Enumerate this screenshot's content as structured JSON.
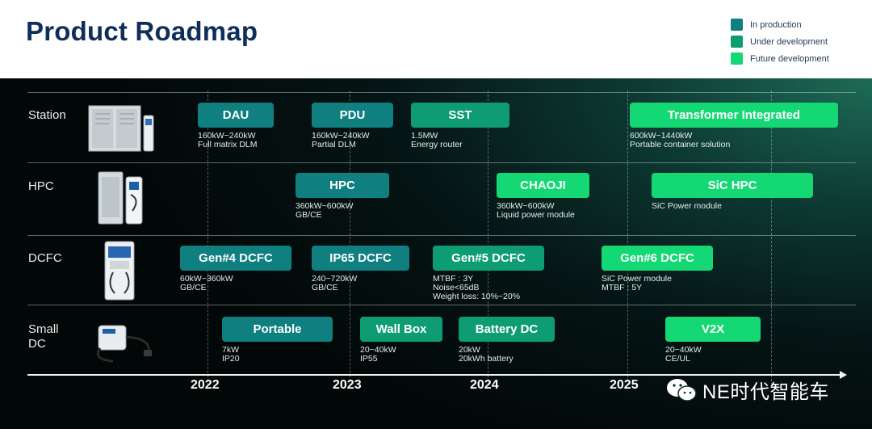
{
  "header": {
    "title": "Product Roadmap"
  },
  "legend": [
    {
      "label": "In production",
      "color": "#0f7f7f"
    },
    {
      "label": "Under development",
      "color": "#0e9c73"
    },
    {
      "label": "Future development",
      "color": "#13d873"
    }
  ],
  "rows": [
    {
      "label": "Station"
    },
    {
      "label": "HPC"
    },
    {
      "label": "DCFC"
    },
    {
      "label": "Small\nDC"
    }
  ],
  "products": {
    "dau": {
      "name": "DAU",
      "desc": [
        "160kW~240kW",
        "Full matrix DLM"
      ]
    },
    "pdu": {
      "name": "PDU",
      "desc": [
        "160kW~240kW",
        "Partial DLM"
      ]
    },
    "sst": {
      "name": "SST",
      "desc": [
        "1.5MW",
        "Energy router"
      ]
    },
    "transformer": {
      "name": "Transformer Integrated",
      "desc": [
        "600kW~1440kW",
        "Portable container solution"
      ]
    },
    "hpc": {
      "name": "HPC",
      "desc": [
        "360kW~600kW",
        "GB/CE"
      ]
    },
    "chaoji": {
      "name": "CHAOJI",
      "desc": [
        "360kW~600kW",
        "Liquid power module"
      ]
    },
    "sic_hpc": {
      "name": "SiC HPC",
      "desc": [
        "SiC Power module"
      ]
    },
    "gen4": {
      "name": "Gen#4 DCFC",
      "desc": [
        "60kW~360kW",
        "GB/CE"
      ]
    },
    "ip65": {
      "name": "IP65 DCFC",
      "desc": [
        "240~720kW",
        "GB/CE"
      ]
    },
    "gen5": {
      "name": "Gen#5 DCFC",
      "desc": [
        "MTBF : 3Y",
        "Noise<65dB",
        "Weight loss: 10%~20%"
      ]
    },
    "gen6": {
      "name": "Gen#6 DCFC",
      "desc": [
        "SiC Power module",
        "MTBF : 5Y"
      ]
    },
    "portable": {
      "name": "Portable",
      "desc": [
        "7kW",
        "IP20"
      ]
    },
    "wallbox": {
      "name": "Wall Box",
      "desc": [
        "20~40kW",
        "IP55"
      ]
    },
    "battery": {
      "name": "Battery DC",
      "desc": [
        "20kW",
        "20kWh battery"
      ]
    },
    "v2x": {
      "name": "V2X",
      "desc": [
        "20~40kW",
        "CE/UL"
      ]
    }
  },
  "years": [
    "2022",
    "2023",
    "2024",
    "2025"
  ],
  "watermark": {
    "text": "NE时代智能车",
    "icon": "wechat-icon"
  }
}
